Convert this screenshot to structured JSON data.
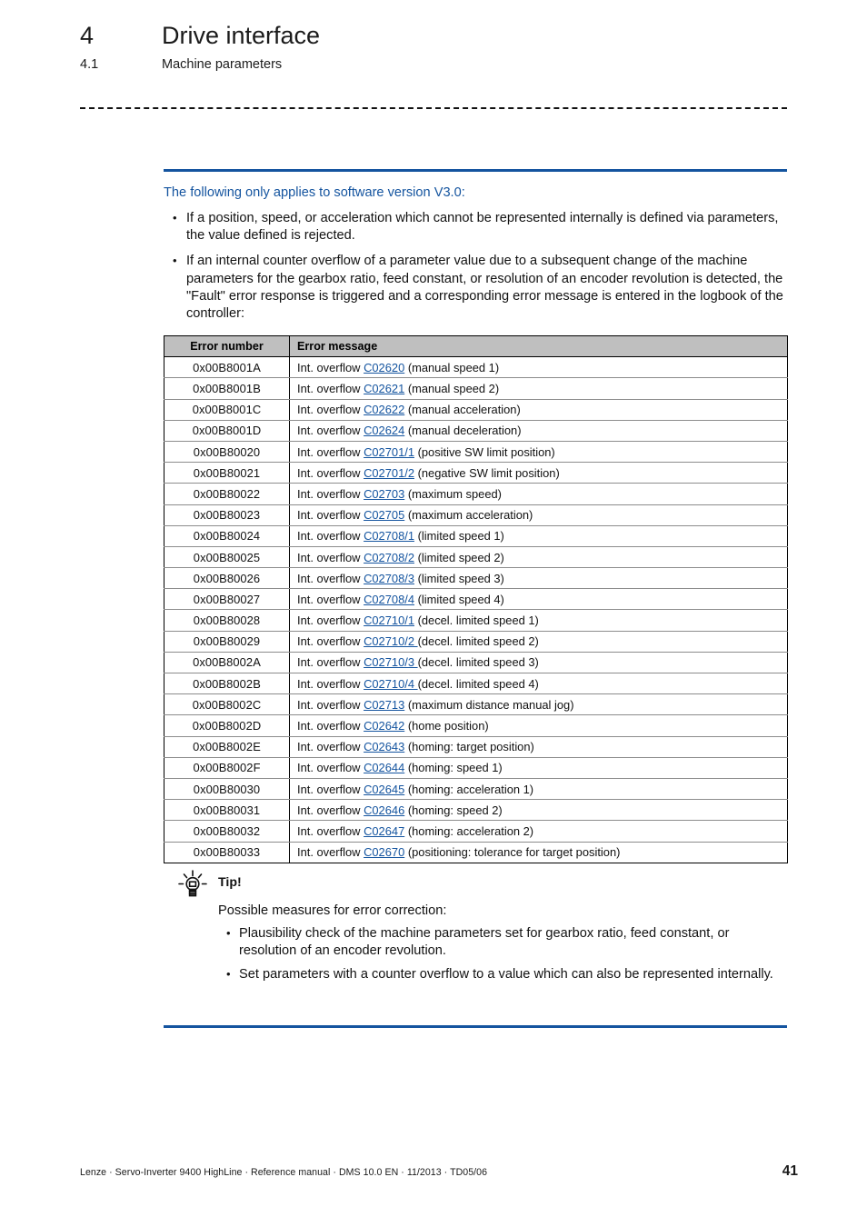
{
  "header": {
    "chapter_number": "4",
    "chapter_title": "Drive interface",
    "section_number": "4.1",
    "section_title": "Machine parameters"
  },
  "colors": {
    "accent_blue": "#14549f",
    "link_blue": "#14549f",
    "table_header_gray": "#bfbfbf"
  },
  "intro": {
    "lead": "The following only applies to software version V3.0:",
    "bullets": [
      "If a position, speed, or acceleration which cannot be represented internally is defined via parameters, the value defined is rejected.",
      "If an internal counter overflow of a parameter value due to a subsequent change of the machine parameters for the gearbox ratio, feed constant, or resolution of an encoder revolution is detected, the \"Fault\" error response is triggered and a corresponding error message is entered in the logbook of the controller:"
    ]
  },
  "table": {
    "columns": [
      "Error number",
      "Error message"
    ],
    "rows": [
      {
        "number": "0x00B8001A",
        "prefix": "Int. overflow ",
        "link": "C02620",
        "suffix": " (manual speed 1)"
      },
      {
        "number": "0x00B8001B",
        "prefix": "Int. overflow ",
        "link": "C02621",
        "suffix": " (manual speed 2)"
      },
      {
        "number": "0x00B8001C",
        "prefix": "Int. overflow ",
        "link": "C02622",
        "suffix": " (manual acceleration)"
      },
      {
        "number": "0x00B8001D",
        "prefix": "Int. overflow ",
        "link": "C02624",
        "suffix": " (manual deceleration)"
      },
      {
        "number": "0x00B80020",
        "prefix": "Int. overflow ",
        "link": "C02701/1",
        "suffix": " (positive SW limit position)"
      },
      {
        "number": "0x00B80021",
        "prefix": "Int. overflow ",
        "link": "C02701/2",
        "suffix": " (negative SW limit position)"
      },
      {
        "number": "0x00B80022",
        "prefix": "Int. overflow ",
        "link": "C02703",
        "suffix": " (maximum speed)"
      },
      {
        "number": "0x00B80023",
        "prefix": "Int. overflow ",
        "link": "C02705",
        "suffix": " (maximum acceleration)"
      },
      {
        "number": "0x00B80024",
        "prefix": "Int. overflow ",
        "link": "C02708/1",
        "suffix": " (limited speed 1)"
      },
      {
        "number": "0x00B80025",
        "prefix": "Int. overflow ",
        "link": "C02708/2",
        "suffix": " (limited speed 2)"
      },
      {
        "number": "0x00B80026",
        "prefix": "Int. overflow ",
        "link": "C02708/3",
        "suffix": " (limited speed 3)"
      },
      {
        "number": "0x00B80027",
        "prefix": "Int. overflow ",
        "link": "C02708/4",
        "suffix": " (limited speed 4)"
      },
      {
        "number": "0x00B80028",
        "prefix": "Int. overflow ",
        "link": "C02710/1",
        "suffix": " (decel. limited speed 1)"
      },
      {
        "number": "0x00B80029",
        "prefix": "Int. overflow ",
        "link": "C02710/2 ",
        "suffix": " (decel. limited speed 2)"
      },
      {
        "number": "0x00B8002A",
        "prefix": "Int. overflow ",
        "link": "C02710/3 ",
        "suffix": " (decel. limited speed 3)"
      },
      {
        "number": "0x00B8002B",
        "prefix": "Int. overflow ",
        "link": "C02710/4 ",
        "suffix": " (decel. limited speed 4)"
      },
      {
        "number": "0x00B8002C",
        "prefix": "Int. overflow ",
        "link": "C02713",
        "suffix": " (maximum distance manual jog)"
      },
      {
        "number": "0x00B8002D",
        "prefix": "Int. overflow ",
        "link": "C02642",
        "suffix": " (home position)"
      },
      {
        "number": "0x00B8002E",
        "prefix": "Int. overflow ",
        "link": "C02643",
        "suffix": " (homing: target position)"
      },
      {
        "number": "0x00B8002F",
        "prefix": "Int. overflow ",
        "link": "C02644",
        "suffix": " (homing: speed 1)"
      },
      {
        "number": "0x00B80030",
        "prefix": "Int. overflow ",
        "link": "C02645",
        "suffix": " (homing: acceleration 1)"
      },
      {
        "number": "0x00B80031",
        "prefix": "Int. overflow ",
        "link": "C02646",
        "suffix": " (homing: speed 2)"
      },
      {
        "number": "0x00B80032",
        "prefix": "Int. overflow ",
        "link": "C02647",
        "suffix": " (homing: acceleration 2)"
      },
      {
        "number": "0x00B80033",
        "prefix": "Int. overflow ",
        "link": "C02670",
        "suffix": " (positioning: tolerance for target position)"
      }
    ]
  },
  "tip": {
    "icon": "lightbulb-icon",
    "title": "Tip!",
    "intro": "Possible measures for error correction:",
    "bullets": [
      "Plausibility check of the machine parameters set for gearbox ratio, feed constant, or resolution of an encoder revolution.",
      "Set parameters with a counter overflow to a value which can also be represented internally."
    ]
  },
  "footer": {
    "text": "Lenze · Servo-Inverter 9400 HighLine · Reference manual · DMS 10.0 EN · 11/2013 · TD05/06",
    "page": "41"
  }
}
